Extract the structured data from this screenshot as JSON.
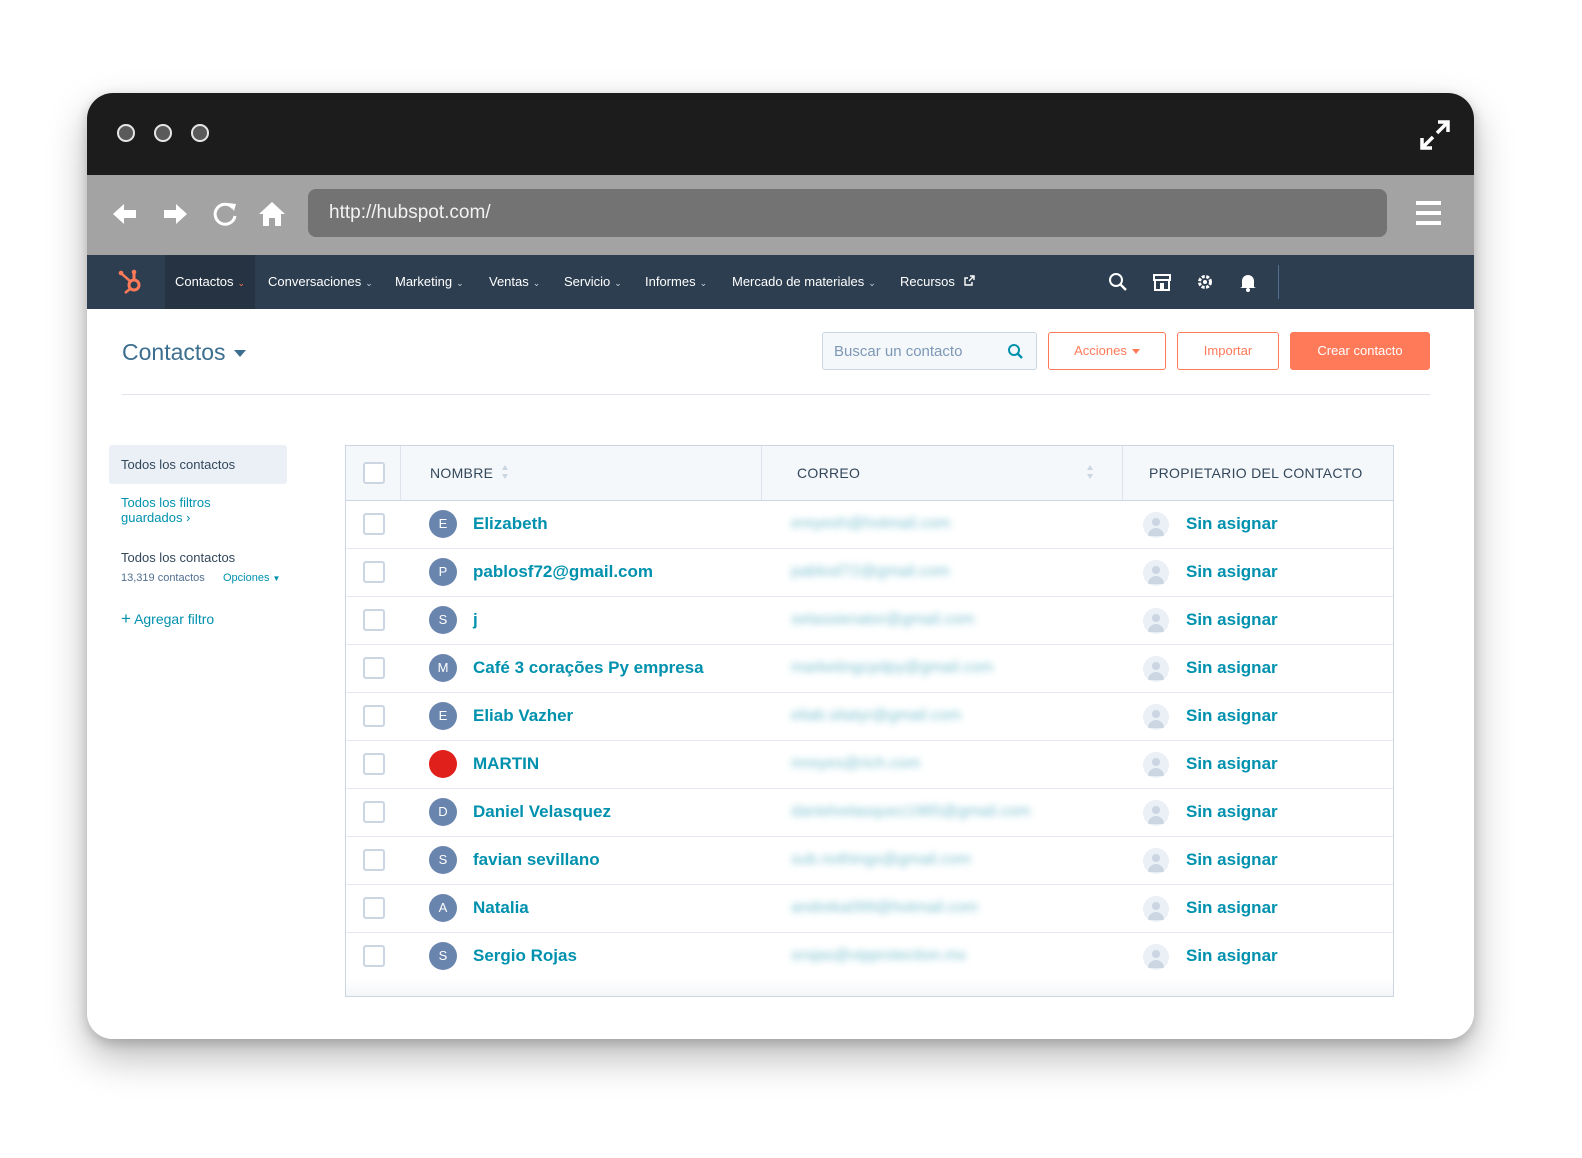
{
  "browser": {
    "url": "http://hubspot.com/"
  },
  "nav": {
    "items": [
      {
        "label": "Contactos",
        "active": true
      },
      {
        "label": "Conversaciones"
      },
      {
        "label": "Marketing"
      },
      {
        "label": "Ventas"
      },
      {
        "label": "Servicio"
      },
      {
        "label": "Informes"
      },
      {
        "label": "Mercado de materiales"
      },
      {
        "label": "Recursos"
      }
    ],
    "icons": [
      "search-icon",
      "marketplace-icon",
      "gear-icon",
      "bell-icon"
    ]
  },
  "header": {
    "title": "Contactos",
    "search_placeholder": "Buscar un contacto",
    "actions_label": "Acciones",
    "import_label": "Importar",
    "create_label": "Crear contacto"
  },
  "sidebar": {
    "active_view": "Todos los contactos",
    "saved_filters": "Todos los filtros guardados",
    "current_view": "Todos los contactos",
    "count": "13,319 contactos",
    "options": "Opciones",
    "add_filter": "Agregar filtro"
  },
  "table": {
    "headers": {
      "name": "NOMBRE",
      "email": "CORREO",
      "owner": "PROPIETARIO DEL CONTACTO"
    },
    "rows": [
      {
        "initial": "E",
        "name": "Elizabeth",
        "email": "ereyesh@hotmail.com",
        "owner": "Sin asignar"
      },
      {
        "initial": "P",
        "name": "pablosf72@gmail.com",
        "email": "pablosf72@gmail.com",
        "owner": "Sin asignar"
      },
      {
        "initial": "S",
        "name": "j",
        "email": "selassienator@gmail.com",
        "owner": "Sin asignar"
      },
      {
        "initial": "M",
        "name": "Café 3 corações Py empresa",
        "email": "marketingcpdpy@gmail.com",
        "owner": "Sin asignar"
      },
      {
        "initial": "E",
        "name": "Eliab Vazher",
        "email": "eliab.sitatyr@gmail.com",
        "owner": "Sin asignar"
      },
      {
        "initial": "",
        "name": "MARTIN",
        "email": "mreyes@rich.com",
        "owner": "Sin asignar",
        "avatar_color": "#e0201a"
      },
      {
        "initial": "D",
        "name": "Daniel Velasquez",
        "email": "danielvelasquez1985@gmail.com",
        "owner": "Sin asignar"
      },
      {
        "initial": "S",
        "name": "favian sevillano",
        "email": "sub.nothings@gmail.com",
        "owner": "Sin asignar"
      },
      {
        "initial": "A",
        "name": "Natalia",
        "email": "andreka099@hotmail.com",
        "owner": "Sin asignar"
      },
      {
        "initial": "S",
        "name": "Sergio Rojas",
        "email": "srojas@vipprotection.mx",
        "owner": "Sin asignar"
      }
    ]
  },
  "colors": {
    "nav_bg": "#2d3e50",
    "accent": "#ff7a59",
    "link": "#0091ae"
  }
}
